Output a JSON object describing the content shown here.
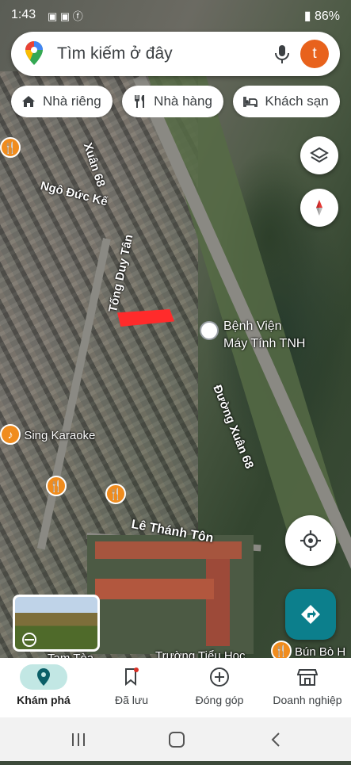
{
  "status_bar": {
    "time": "1:43",
    "battery": "86%"
  },
  "search": {
    "placeholder": "Tìm kiếm ở đây",
    "avatar_letter": "t"
  },
  "chips": [
    {
      "label": "Nhà riêng",
      "icon": "home-icon"
    },
    {
      "label": "Nhà hàng",
      "icon": "restaurant-icon"
    },
    {
      "label": "Khách sạn",
      "icon": "hotel-icon"
    }
  ],
  "map": {
    "labels": {
      "xuan68_top": "Xuân 68",
      "ngo_duc_ke": "Ngô Đức Kế",
      "tong_duy_tan": "Tống Duy Tân",
      "duong_xuan68": "Đường Xuân 68",
      "le_thanh_ton": "Lê Thánh Tôn",
      "karaoke": "I Sing Karaoke",
      "bun_bo": "Bún Bò H",
      "truong": "Trường Tiểu Học",
      "tam_toa": "Tam Tòa"
    },
    "hospital": {
      "line1": "Bệnh Viện",
      "line2": "Máy Tính TNH"
    }
  },
  "bottom_nav": [
    {
      "label": "Khám phá",
      "icon": "explore-pin-icon",
      "active": true
    },
    {
      "label": "Đã lưu",
      "icon": "bookmark-icon",
      "active": false
    },
    {
      "label": "Đóng góp",
      "icon": "add-circle-icon",
      "active": false
    },
    {
      "label": "Doanh nghiệp",
      "icon": "store-icon",
      "active": false
    }
  ],
  "colors": {
    "accent": "#0c7f8c",
    "poi": "#f08c1e",
    "avatar": "#e8621c",
    "marker": "#ff2b2b"
  }
}
